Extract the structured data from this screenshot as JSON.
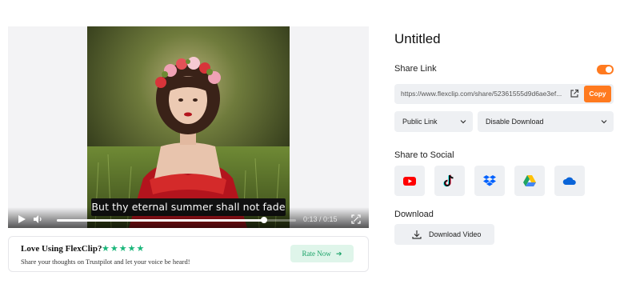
{
  "project": {
    "title": "Untitled"
  },
  "player": {
    "subtitle": "But thy eternal summer shall not fade",
    "time": "0:13 / 0:15",
    "progress": 0.867
  },
  "rate": {
    "title": "Love Using FlexClip?",
    "stars": "★★★★★",
    "subtitle": "Share your thoughts on Trustpilot and let your voice be heard!",
    "button_label": "Rate Now"
  },
  "share": {
    "label": "Share Link",
    "toggle_on": true,
    "link": "https://www.flexclip.com/share/52361555d9d6ae3ef...",
    "copy_label": "Copy",
    "visibility": "Public Link",
    "download_option": "Disable Download"
  },
  "social": {
    "label": "Share to Social",
    "items": [
      "youtube-icon",
      "tiktok-icon",
      "dropbox-icon",
      "google-drive-icon",
      "onedrive-icon"
    ]
  },
  "download": {
    "label": "Download",
    "button_label": "Download Video"
  },
  "colors": {
    "accent": "#ff7a1f",
    "rate_green": "#19a267",
    "star_green": "#1ab67a"
  }
}
